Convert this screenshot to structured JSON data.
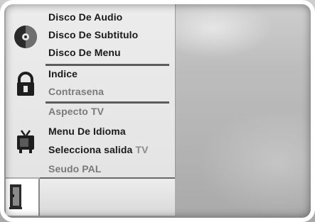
{
  "menu": {
    "disc": {
      "icon": "disc-icon",
      "items": [
        {
          "label": "Disco De Audio"
        },
        {
          "label": "Disco De Subtitulo"
        },
        {
          "label": "Disco De Menu"
        }
      ]
    },
    "lock": {
      "icon": "padlock-icon",
      "items": [
        {
          "label": "Indice"
        },
        {
          "label": "Contrasena"
        }
      ]
    },
    "tv": {
      "icon": "tv-icon",
      "items": [
        {
          "label": "Aspecto TV"
        },
        {
          "label": "Menu De Idioma"
        },
        {
          "label_part1": "Selecciona salida",
          "label_part2": "TV"
        },
        {
          "label": "Seudo PAL"
        }
      ]
    },
    "bottom": {
      "icon": "door-exit-icon"
    }
  }
}
